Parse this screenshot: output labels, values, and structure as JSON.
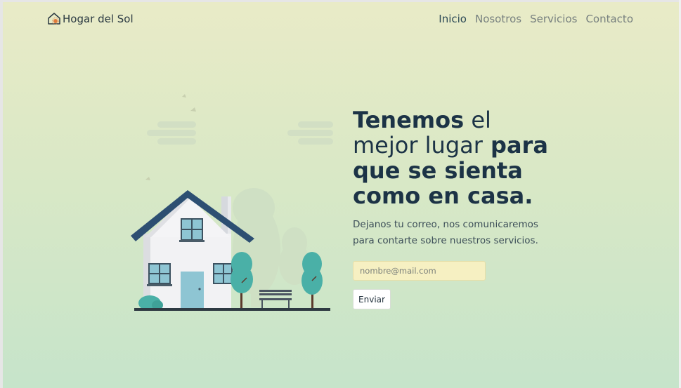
{
  "brand": {
    "name": "Hogar del Sol",
    "icon": "house-sun-icon"
  },
  "nav": {
    "items": [
      {
        "label": "Inicio",
        "active": true
      },
      {
        "label": "Nosotros",
        "active": false
      },
      {
        "label": "Servicios",
        "active": false
      },
      {
        "label": "Contacto",
        "active": false
      }
    ]
  },
  "hero": {
    "headline_parts": [
      "Tenemos",
      " el ",
      "mejor lugar",
      " para ",
      "que se sienta",
      "como en casa."
    ],
    "subtext": "Dejanos tu correo, nos comunicaremos para contarte sobre nuestros servicios.",
    "email_placeholder": "nombre@mail.com",
    "submit_label": "Enviar"
  },
  "colors": {
    "accent": "#1c3346",
    "roof": "#2d4f72",
    "tree": "#4ab0a7",
    "input_bg": "#f6f0c2"
  }
}
